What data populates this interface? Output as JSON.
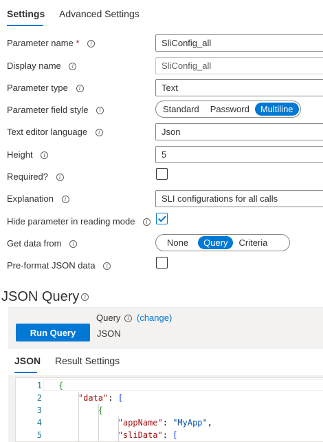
{
  "tabs": [
    "Settings",
    "Advanced Settings"
  ],
  "form": {
    "parameter_name_label": "Parameter name",
    "parameter_name_required": "*",
    "parameter_name_value": "SliConfig_all",
    "display_name_label": "Display name",
    "display_name_placeholder": "SliConfig_all",
    "parameter_type_label": "Parameter type",
    "parameter_type_value": "Text",
    "field_style_label": "Parameter field style",
    "field_style_options": [
      "Standard",
      "Password",
      "Multiline"
    ],
    "field_style_selected": "Multiline",
    "editor_language_label": "Text editor language",
    "editor_language_value": "Json",
    "height_label": "Height",
    "height_value": "5",
    "required_label": "Required?",
    "required_checked": false,
    "explanation_label": "Explanation",
    "explanation_value": "SLI configurations for all calls",
    "hide_param_label": "Hide parameter in reading mode",
    "hide_param_checked": true,
    "get_data_label": "Get data from",
    "get_data_options": [
      "None",
      "Query",
      "Criteria"
    ],
    "get_data_selected": "Query",
    "preformat_label": "Pre-format JSON data",
    "preformat_checked": false
  },
  "json_query": {
    "title": "JSON Query",
    "run_button": "Run Query",
    "query_label": "Query",
    "change_link": "(change)",
    "query_value": "JSON",
    "tabs": [
      "JSON",
      "Result Settings"
    ]
  },
  "editor": {
    "line_numbers": [
      "1",
      "2",
      "3",
      "4",
      "5"
    ],
    "lines": [
      "{",
      "    \"data\": [",
      "        {",
      "            \"appName\": \"MyApp\",",
      "            \"sliData\": ["
    ]
  },
  "colors": {
    "accent": "#0078d4",
    "required": "#a4262c"
  }
}
